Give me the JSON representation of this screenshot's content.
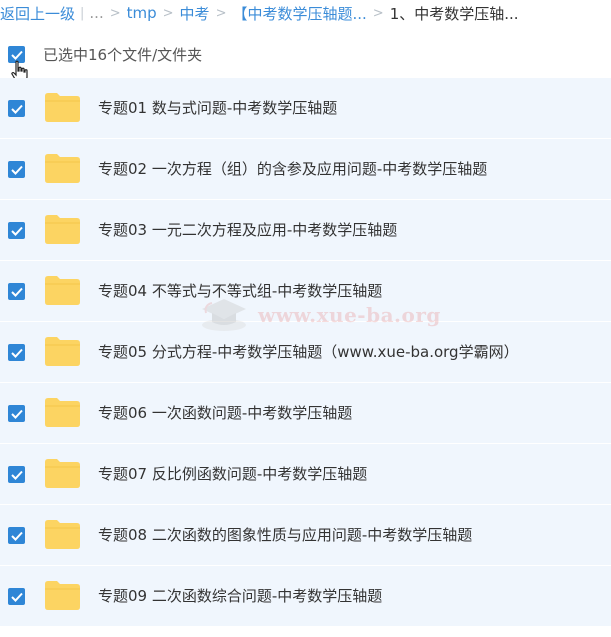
{
  "breadcrumb": {
    "back": "返回上一级",
    "ellipsis": "...",
    "crumbs": [
      "tmp",
      "中考",
      "【中考数学压轴题...",
      "1、中考数学压轴..."
    ]
  },
  "header": {
    "selection_text": "已选中16个文件/文件夹"
  },
  "files": [
    {
      "name": "专题01 数与式问题-中考数学压轴题"
    },
    {
      "name": "专题02 一次方程（组）的含参及应用问题-中考数学压轴题"
    },
    {
      "name": "专题03 一元二次方程及应用-中考数学压轴题"
    },
    {
      "name": "专题04 不等式与不等式组-中考数学压轴题"
    },
    {
      "name": "专题05 分式方程-中考数学压轴题（www.xue-ba.org学霸网）"
    },
    {
      "name": "专题06 一次函数问题-中考数学压轴题"
    },
    {
      "name": "专题07 反比例函数问题-中考数学压轴题"
    },
    {
      "name": "专题08 二次函数的图象性质与应用问题-中考数学压轴题"
    },
    {
      "name": "专题09 二次函数综合问题-中考数学压轴题"
    }
  ],
  "watermark": {
    "text": "www.xue-ba.org"
  },
  "colors": {
    "link": "#3b8cd8",
    "checkbox": "#2f86d6",
    "row_background": "#f0f6fd",
    "folder": "#fcd462"
  },
  "icons": {
    "checkbox": "checkmark-icon",
    "folder": "folder-icon",
    "cursor": "hand-cursor-icon"
  }
}
